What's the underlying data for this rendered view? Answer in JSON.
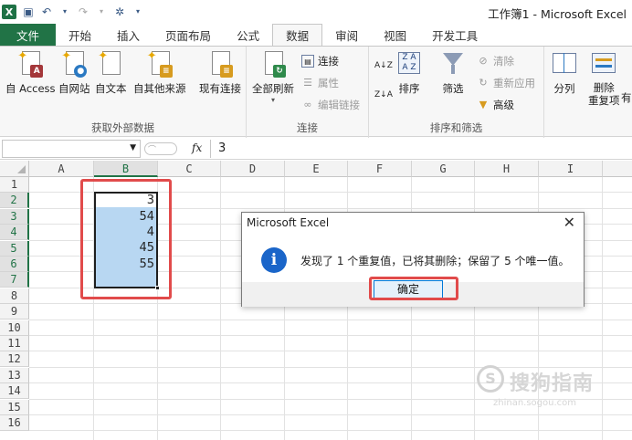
{
  "window": {
    "title": "工作簿1 - Microsoft Excel"
  },
  "tabs": [
    "文件",
    "开始",
    "插入",
    "页面布局",
    "公式",
    "数据",
    "审阅",
    "视图",
    "开发工具"
  ],
  "ribbon": {
    "external": {
      "access": "自 Access",
      "web": "自网站",
      "text": "自文本",
      "other": "自其他来源",
      "existing": "现有连接",
      "group": "获取外部数据"
    },
    "connections": {
      "refresh": "全部刷新",
      "conn": "连接",
      "props": "属性",
      "edit_links": "编辑链接",
      "group": "连接"
    },
    "sortfilter": {
      "sort": "排序",
      "filter": "筛选",
      "clear": "清除",
      "reapply": "重新应用",
      "advanced": "高级",
      "group": "排序和筛选"
    },
    "tools": {
      "split": "分列",
      "remove_dup": "删除\n重复项",
      "more": "有"
    }
  },
  "formula_bar": {
    "fx": "fx",
    "value": "3"
  },
  "grid": {
    "columns": [
      "A",
      "B",
      "C",
      "D",
      "E",
      "F",
      "G",
      "H",
      "I"
    ],
    "rows": [
      "1",
      "2",
      "3",
      "4",
      "5",
      "6",
      "7",
      "8",
      "9",
      "10",
      "11",
      "12",
      "13",
      "14",
      "15",
      "16"
    ],
    "values": [
      "3",
      "54",
      "4",
      "45",
      "55"
    ]
  },
  "dialog": {
    "title": "Microsoft Excel",
    "icon": "i",
    "message": "发现了 1 个重复值，已将其删除；保留了 5 个唯一值。",
    "ok": "确定"
  },
  "watermark": {
    "text": "搜狗指南",
    "sub": "zhinan.sogou.com",
    "mark": "S"
  }
}
